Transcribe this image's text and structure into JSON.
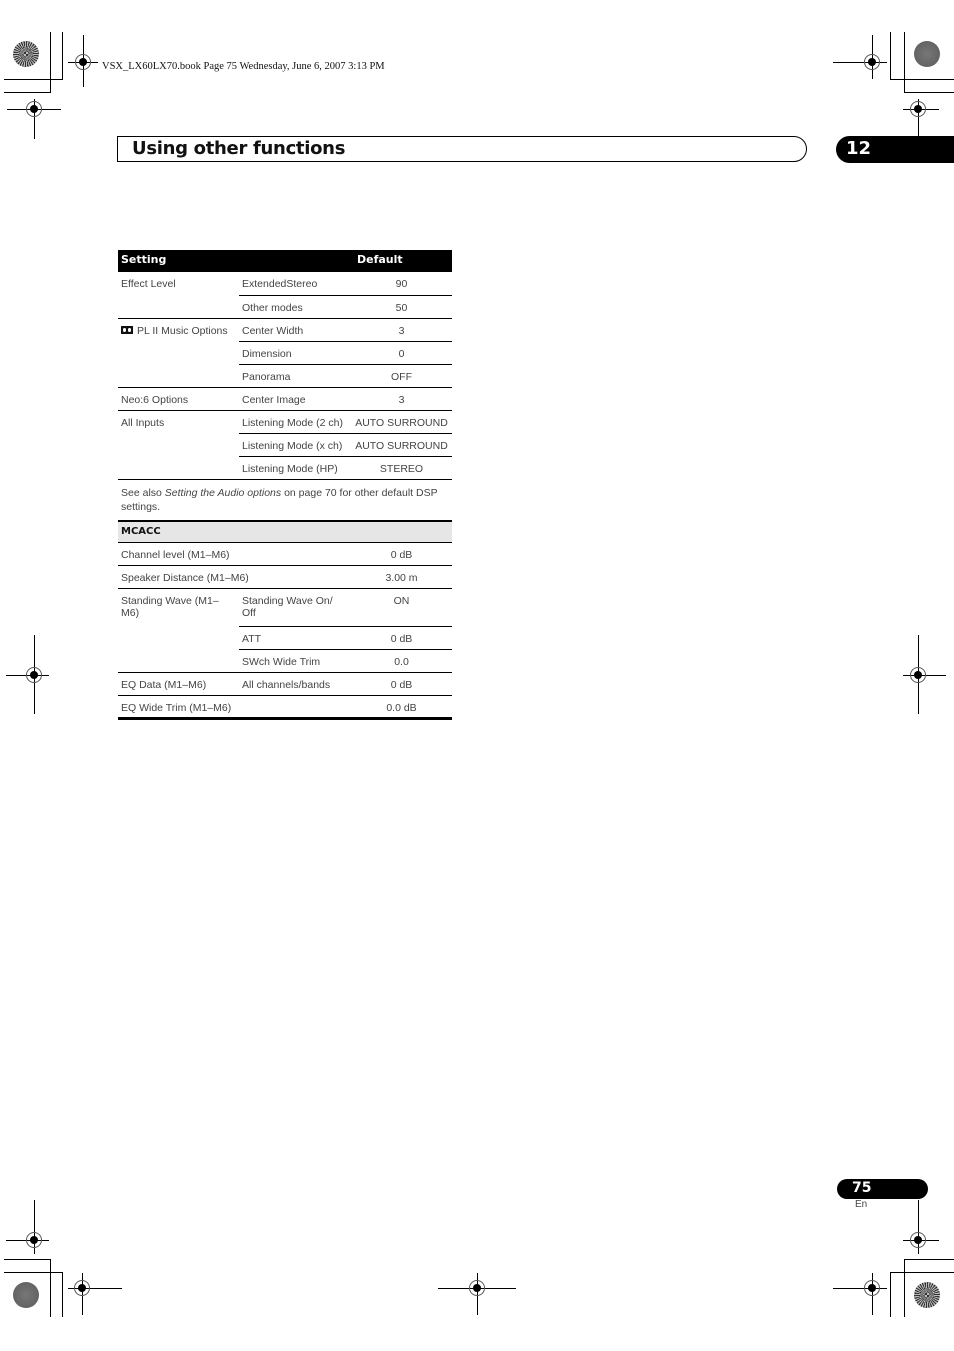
{
  "print_header": "VSX_LX60LX70.book  Page 75  Wednesday, June 6, 2007  3:13 PM",
  "page_title": "Using other functions",
  "chapter_number": "12",
  "table": {
    "headers": {
      "setting": "Setting",
      "default": "Default"
    },
    "rows": [
      {
        "group": "Effect Level",
        "sub": "ExtendedStereo",
        "value": "90"
      },
      {
        "group": "",
        "sub": "Other modes",
        "value": "50"
      },
      {
        "group": "PL II Music Options",
        "group_icon": "dolby-icon",
        "sub": "Center Width",
        "value": "3"
      },
      {
        "group": "",
        "sub": "Dimension",
        "value": "0"
      },
      {
        "group": "",
        "sub": "Panorama",
        "value": "OFF"
      },
      {
        "group": "Neo:6 Options",
        "sub": "Center Image",
        "value": "3"
      },
      {
        "group": "All Inputs",
        "sub": "Listening Mode (2 ch)",
        "value": "AUTO SURROUND"
      },
      {
        "group": "",
        "sub": "Listening Mode (x ch)",
        "value": "AUTO SURROUND"
      },
      {
        "group": "",
        "sub": "Listening Mode (HP)",
        "value": "STEREO"
      }
    ],
    "note": {
      "prefix": "See also ",
      "italic": "Setting the Audio options",
      "suffix": " on page 70 for other default DSP settings."
    },
    "section_title": "MCACC",
    "mcacc_rows": [
      {
        "group": "Channel level (M1–M6)",
        "sub": "",
        "value": "0 dB"
      },
      {
        "group": "Speaker Distance (M1–M6)",
        "sub": "",
        "value": "3.00 m"
      },
      {
        "group": "Standing Wave (M1–M6)",
        "sub": "Standing Wave On/ Off",
        "value": "ON"
      },
      {
        "group": "",
        "sub": "ATT",
        "value": "0 dB"
      },
      {
        "group": "",
        "sub": "SWch Wide Trim",
        "value": "0.0"
      },
      {
        "group": "EQ Data (M1–M6)",
        "sub": "All channels/bands",
        "value": "0 dB"
      },
      {
        "group": "EQ Wide Trim (M1–M6)",
        "sub": "",
        "value": "0.0 dB"
      }
    ]
  },
  "page_number": "75",
  "language": "En"
}
